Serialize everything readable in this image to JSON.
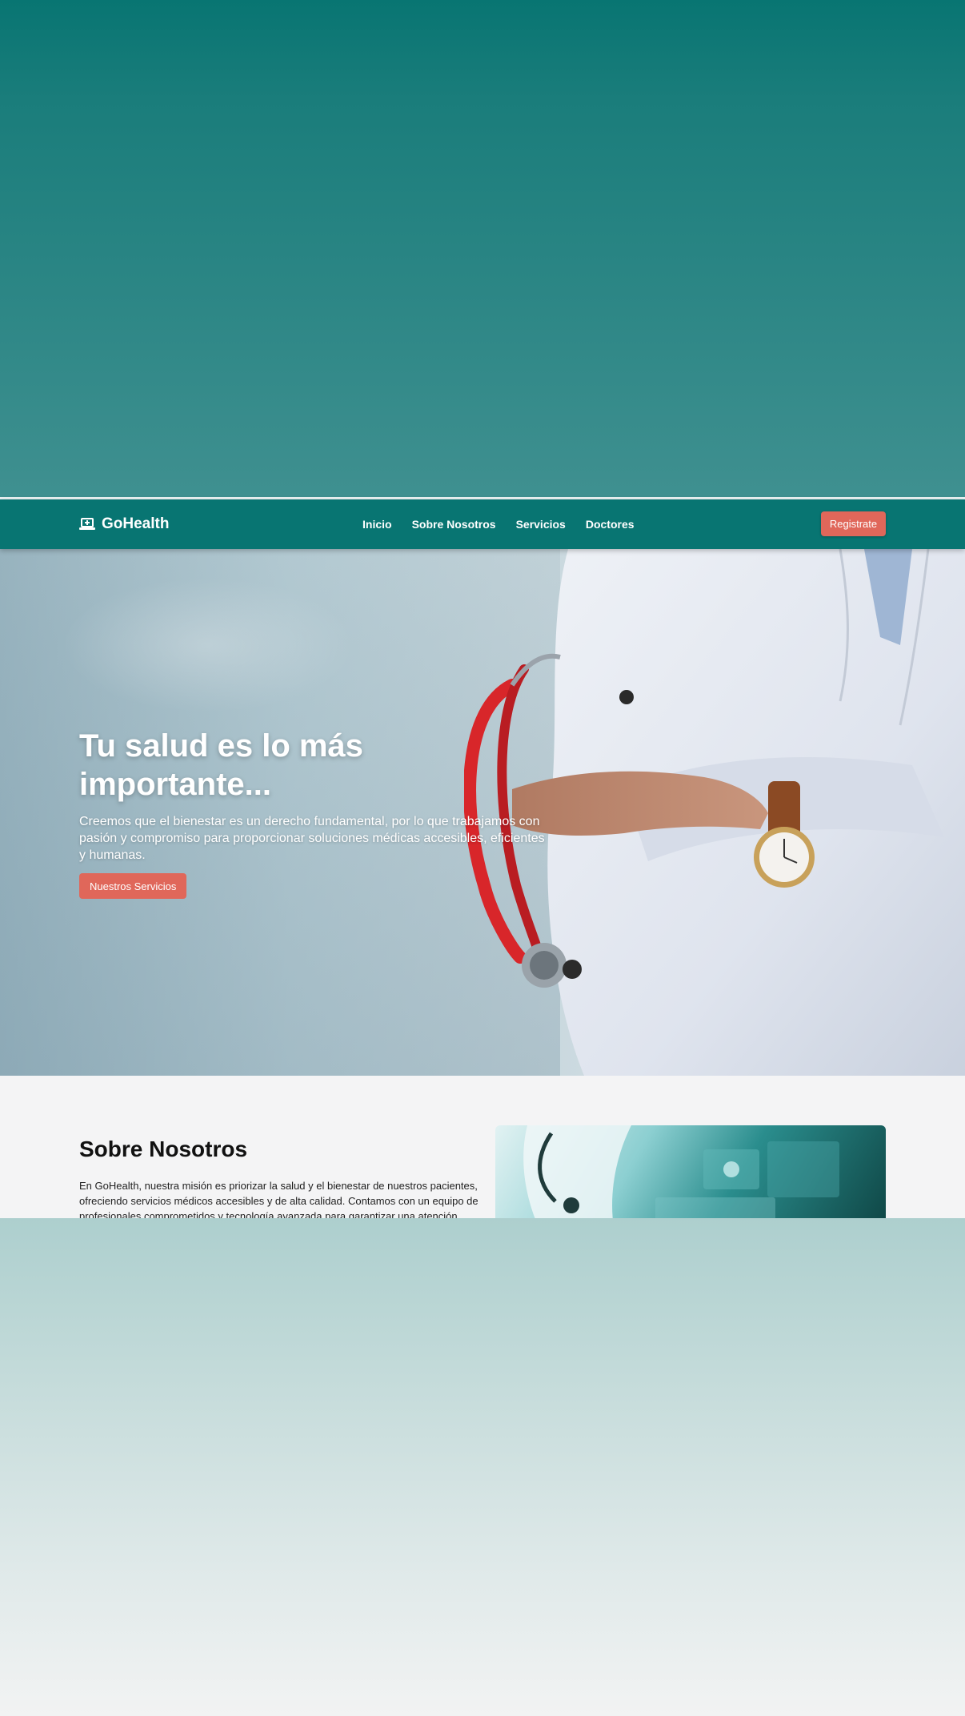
{
  "brand": {
    "name": "GoHealth",
    "icon": "laptop-medical-icon"
  },
  "nav": {
    "links": [
      {
        "label": "Inicio"
      },
      {
        "label": "Sobre Nosotros"
      },
      {
        "label": "Servicios"
      },
      {
        "label": "Doctores"
      }
    ],
    "cta_label": "Registrate"
  },
  "hero": {
    "title": "Tu salud es lo más importante...",
    "text": "Creemos que el bienestar es un derecho fundamental, por lo que trabajamos con pasión y compromiso para proporcionar soluciones médicas accesibles, eficientes y humanas.",
    "button_label": "Nuestros Servicios"
  },
  "about": {
    "title": "Sobre Nosotros",
    "text": "En GoHealth, nuestra misión es priorizar la salud y el bienestar de nuestros pacientes, ofreciendo servicios médicos accesibles y de alta calidad. Contamos con un equipo de profesionales comprometidos y tecnología avanzada para garantizar una atención"
  },
  "colors": {
    "primary": "#087572",
    "accent": "#e0675a",
    "background": "#f4f4f5"
  }
}
